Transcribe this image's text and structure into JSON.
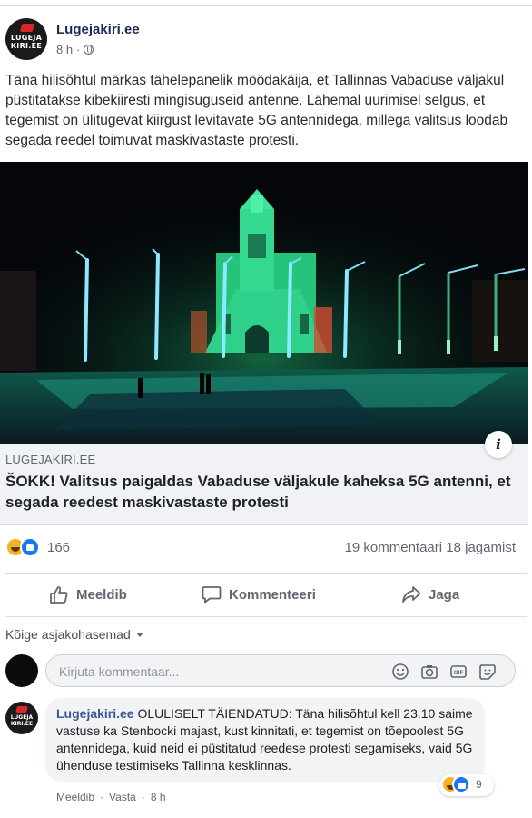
{
  "post": {
    "page_name": "Lugejakiri.ee",
    "time": "8 h",
    "dot": "·",
    "text": "Täna hilisõhtul märkas tähelepanelik möödakäija, et Tallinnas Vabaduse väljakul püstitatakse kibekiiresti mingisuguseid antenne. Lähemal uurimisel selgus, et tegemist on ülitugevat kiirgust levitavate 5G antennidega, millega valitsus loodab segada reedel toimuvat maskivastaste protesti.",
    "avatar_logo_lines": [
      "LUGEJA",
      "KIRI.EE"
    ]
  },
  "link_preview": {
    "domain": "LUGEJAKIRI.EE",
    "title": "ŠOKK! Valitsus paigaldas Vabaduse väljakule kaheksa 5G antenni, et segada reedest maskivastaste protesti",
    "info_label": "i"
  },
  "stats": {
    "reaction_count": "166",
    "comments": "19 kommentaari",
    "shares": "18 jagamist"
  },
  "actions": {
    "like": "Meeldib",
    "comment": "Kommenteeri",
    "share": "Jaga"
  },
  "comments_section": {
    "sort_label": "Kõige asjakohasemad",
    "input_placeholder": "Kirjuta kommentaar..."
  },
  "reply": {
    "author": "Lugejakiri.ee",
    "text": "OLULISELT TÄIENDATUD: Täna hilisõhtul kell 23.10 saime vastuse ka Stenbocki majast, kust kinnitati, et tegemist on tõepoolest 5G antennidega, kuid neid ei püstitatud reedese protesti segamiseks, vaid 5G ühenduse testimiseks Tallinna kesklinnas.",
    "reaction_count": "9",
    "like_link": "Meeldib",
    "reply_link": "Vasta",
    "time": "8 h",
    "dot": "·"
  },
  "colors": {
    "accent": "#1877f2",
    "page_name": "#1d2a57",
    "haha": "#f7b125",
    "logo_red": "#d9262b",
    "church_green": "#2fd08a",
    "light_pole": "#8ee8ff"
  }
}
